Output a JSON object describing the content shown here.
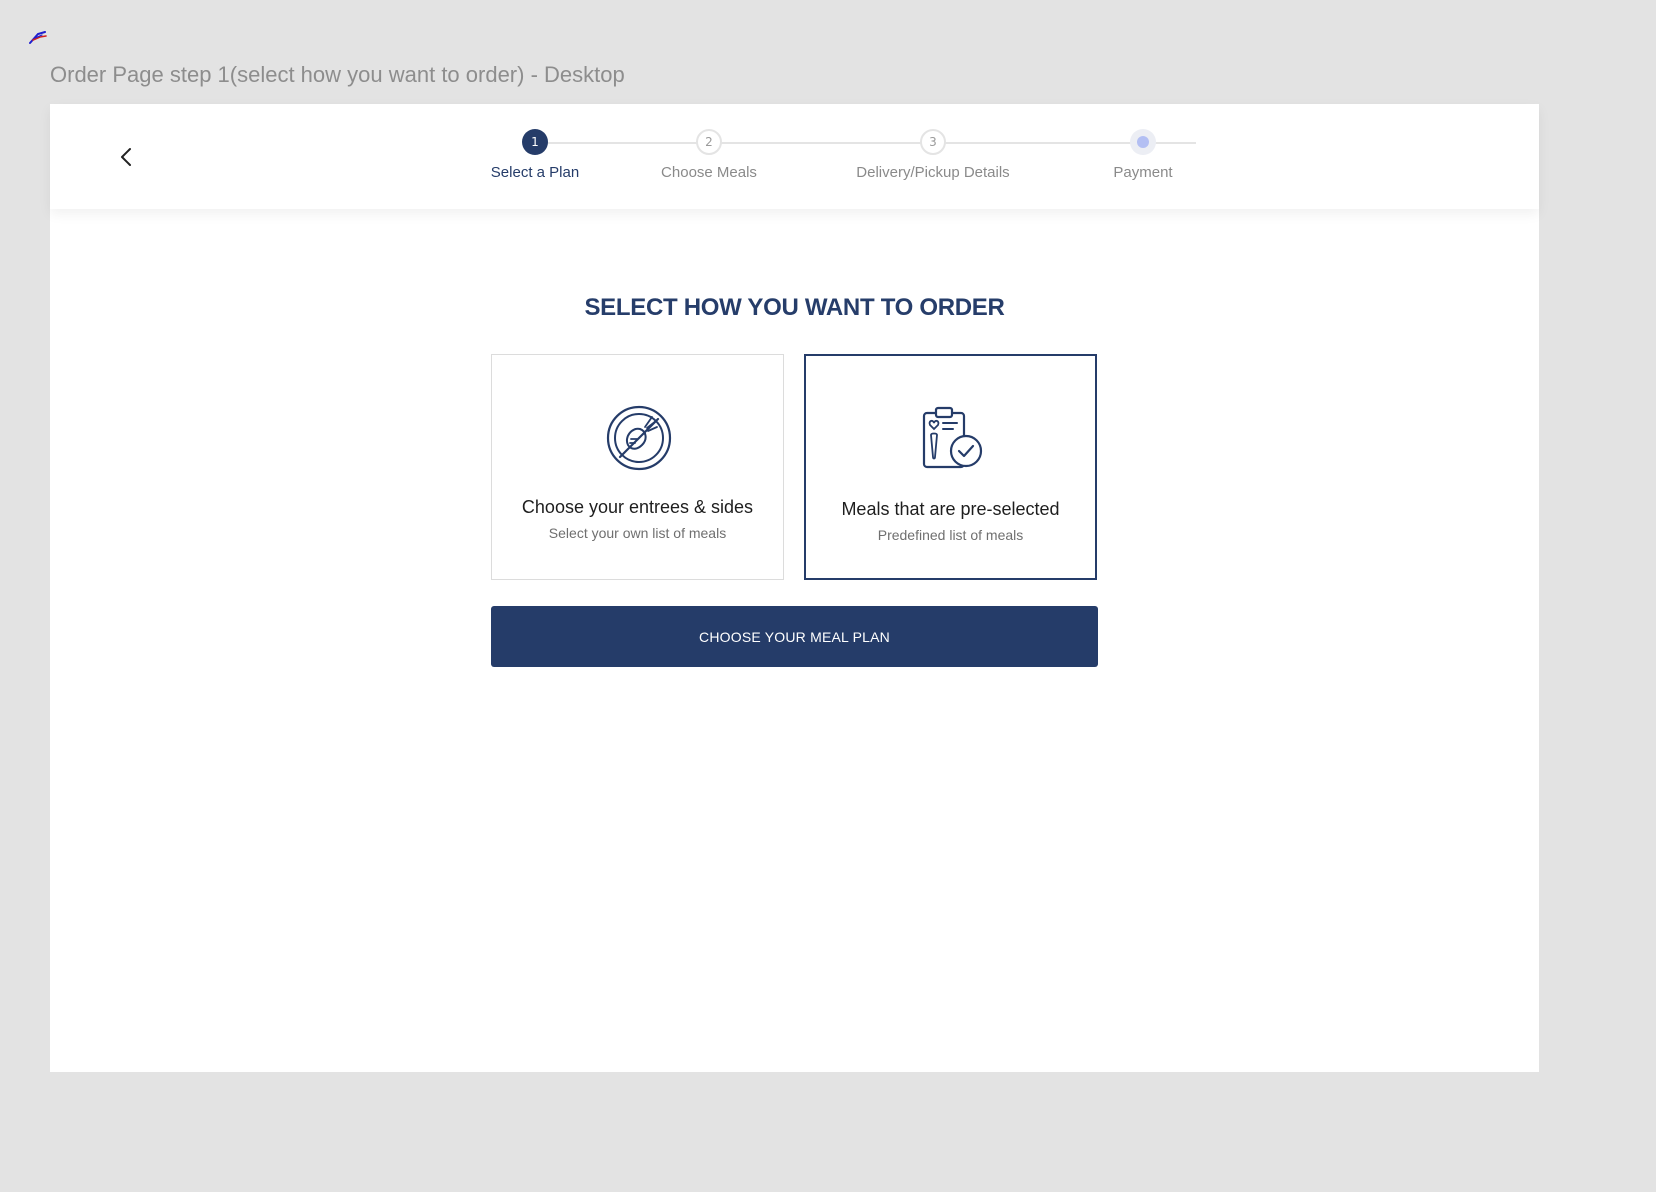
{
  "frame": {
    "title": "Order Page step 1(select how you want to order) - Desktop"
  },
  "header": {
    "back_icon": "chevron-left-icon",
    "steps": [
      {
        "number": "1",
        "label": "Select a Plan",
        "state": "active"
      },
      {
        "number": "2",
        "label": "Choose Meals",
        "state": "upcoming"
      },
      {
        "number": "3",
        "label": "Delivery/Pickup Details",
        "state": "upcoming"
      },
      {
        "number": "",
        "label": "Payment",
        "state": "upcoming"
      }
    ]
  },
  "main": {
    "heading": "SELECT HOW YOU WANT TO ORDER",
    "options": [
      {
        "icon": "plate-vegetables-icon",
        "title": "Choose your entrees & sides",
        "subtitle": "Select your own list of meals",
        "selected": false
      },
      {
        "icon": "clipboard-check-icon",
        "title": "Meals that are pre-selected",
        "subtitle": "Predefined list of meals",
        "selected": true
      }
    ],
    "cta_label": "CHOOSE YOUR MEAL PLAN"
  },
  "colors": {
    "brand_navy": "#253c69",
    "canvas_gray": "#e3e3e3",
    "payment_dot": "#b3bff3"
  }
}
